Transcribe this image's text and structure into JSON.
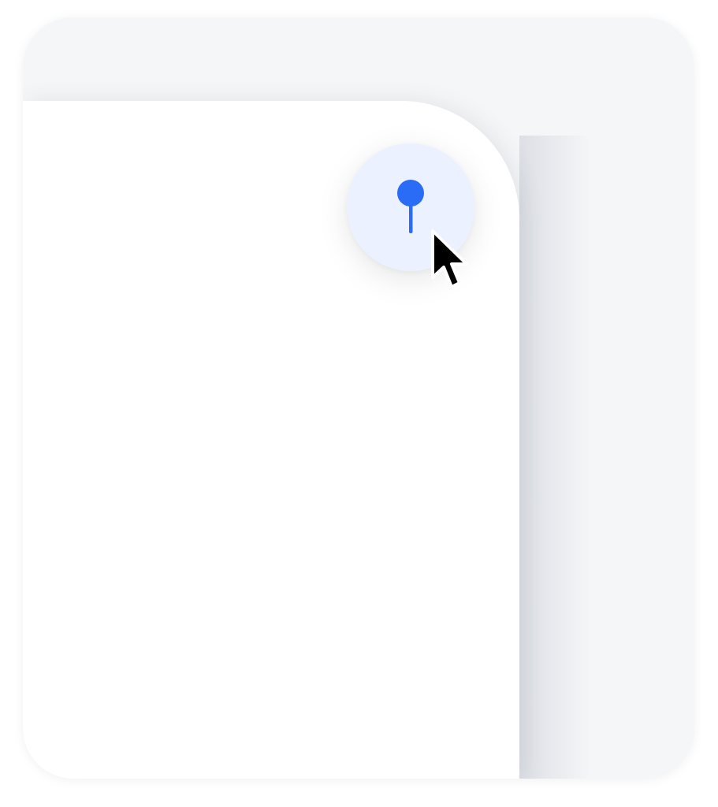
{
  "icons": {
    "pin": "pin-icon",
    "cursor": "mouse-pointer-icon"
  },
  "colors": {
    "frame_background": "#f5f6f8",
    "panel_background": "#ffffff",
    "pin_button_background": "#ebf1fe",
    "pin_accent": "#2b6cf6",
    "cursor_fill": "#000000",
    "cursor_outline": "#ffffff"
  }
}
